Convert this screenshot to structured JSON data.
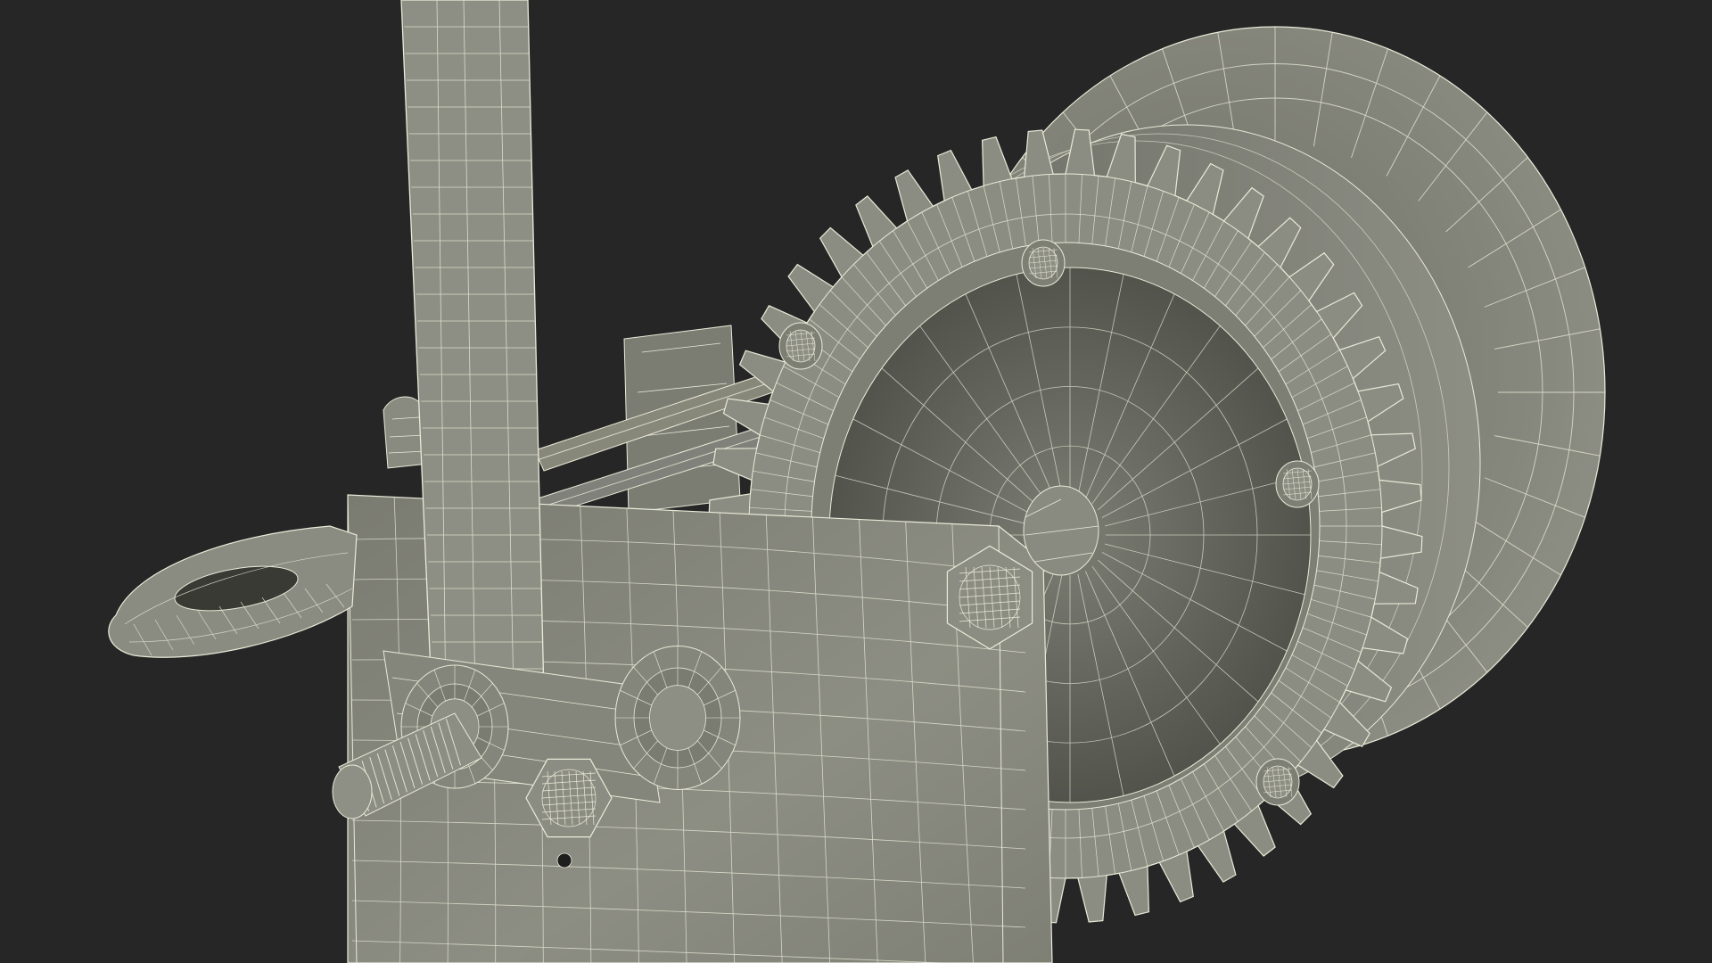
{
  "scene": {
    "subject": "",
    "background_color": "#262626",
    "material_color": "#8a8b80",
    "material_shadow_color": "#5a5b52",
    "wire_color": "#e9ead8",
    "gear_teeth": 48,
    "gear_bolts": 5
  }
}
